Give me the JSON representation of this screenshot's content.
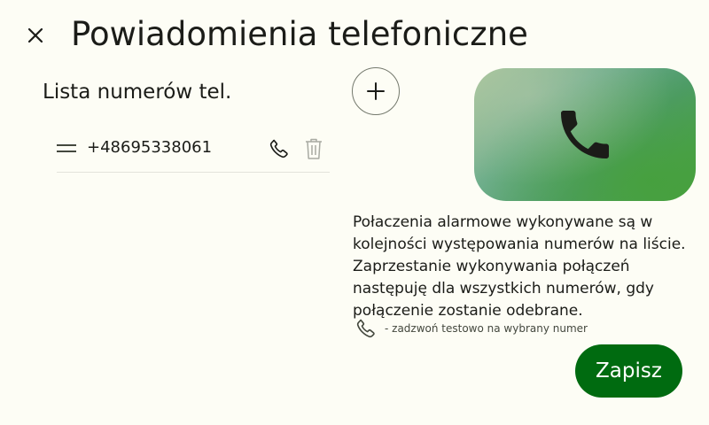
{
  "header": {
    "title": "Powiadomienia telefoniczne",
    "close_icon": "close-icon"
  },
  "phone_list": {
    "title": "Lista numerów tel.",
    "items": [
      {
        "number": "+48695338061",
        "handle_icon": "drag-handle-icon",
        "call_icon": "phone-icon",
        "delete_icon": "trash-icon"
      }
    ],
    "add_icon": "plus-icon"
  },
  "info": {
    "hero_icon": "phone-icon",
    "description": "Połaczenia alarmowe wykonywane są w kolejności występowania numerów na liście. Zaprzestanie wykonywania połączeń następuję dla wszystkich numerów, gdy połączenie zostanie odebrane.",
    "legend_icon": "phone-icon",
    "legend_text": "- zadzwoń testowo na wybrany numer"
  },
  "actions": {
    "save_label": "Zapisz"
  },
  "colors": {
    "background": "#fdfdf5",
    "primary": "#006b10",
    "on_primary": "#ffffff",
    "text": "#1b1c18",
    "trash_disabled": "#a8aaa2"
  }
}
